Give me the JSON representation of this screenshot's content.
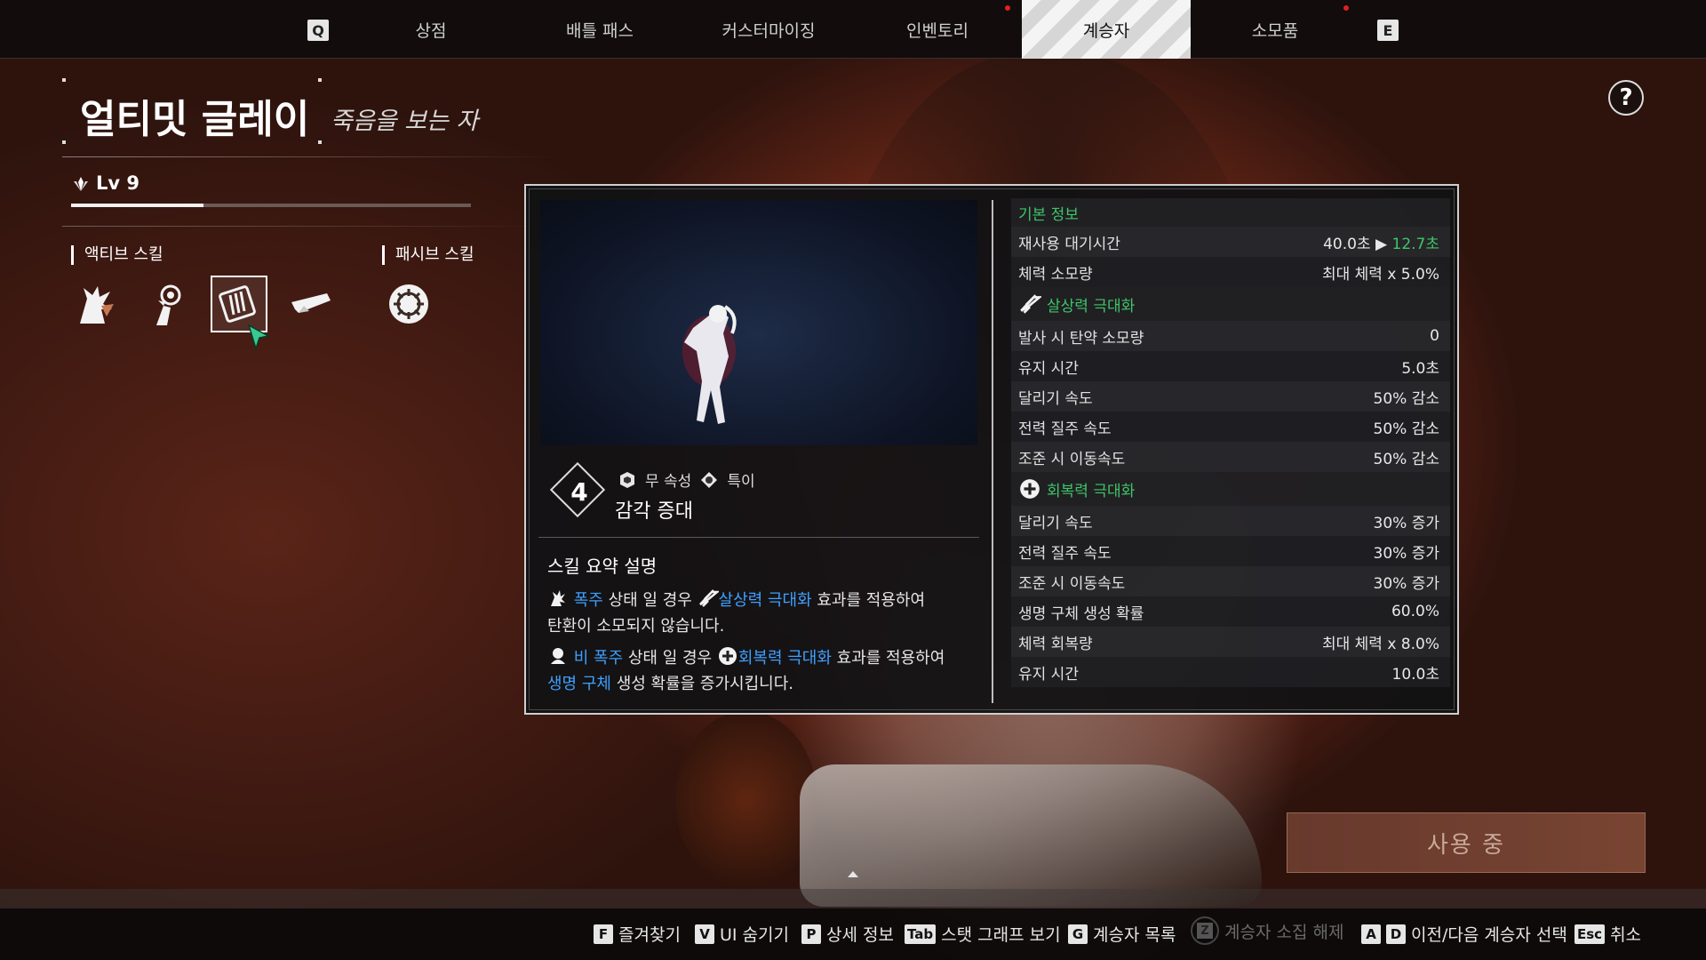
{
  "nav": {
    "left_key": "Q",
    "right_key": "E",
    "tabs": [
      {
        "label": "상점"
      },
      {
        "label": "배틀 패스"
      },
      {
        "label": "커스터마이징"
      },
      {
        "label": "인벤토리"
      },
      {
        "label": "계승자"
      },
      {
        "label": "소모품"
      }
    ],
    "active_tab": "계승자"
  },
  "hero": {
    "name": "얼티밋 글레이",
    "subtitle": "죽음을 보는 자",
    "level": "Lv 9",
    "xp_fraction": 0.33
  },
  "skills": {
    "active_label": "액티브 스킬",
    "passive_label": "패시브 스킬",
    "active_icons": [
      "skill-1-icon",
      "skill-2-icon",
      "skill-3-icon",
      "skill-4-icon"
    ],
    "selected_index": 2,
    "passive_icons": [
      "passive-skill-icon"
    ]
  },
  "detail": {
    "skill_number": "4",
    "attribute": "무 속성",
    "type": "특이",
    "skill_name": "감각 증대",
    "summary_title": "스킬 요약 설명",
    "line1_a": "폭주",
    "line1_b": " 상태 일 경우 ",
    "line1_c": "살상력 극대화",
    "line1_d": " 효과를 적용하여",
    "line1_e": "탄환이 소모되지 않습니다.",
    "line2_a": "비 폭주",
    "line2_b": " 상태 일 경우 ",
    "line2_c": "회복력 극대화",
    "line2_d": " 효과를 적용하여",
    "line2_e": "생명 구체",
    "line2_f": " 생성 확률을 증가시킵니다."
  },
  "stats": {
    "basic": {
      "title": "기본 정보",
      "rows": [
        {
          "label": "재사용 대기시간",
          "value": "40.0초",
          "value_new": "12.7초"
        },
        {
          "label": "체력 소모량",
          "value": "최대 체력 x 5.0%"
        }
      ]
    },
    "lethality": {
      "title": "살상력 극대화",
      "rows": [
        {
          "label": "발사 시 탄약 소모량",
          "value": "0"
        },
        {
          "label": "유지 시간",
          "value": "5.0초"
        },
        {
          "label": "달리기 속도",
          "value": "50% 감소"
        },
        {
          "label": "전력 질주 속도",
          "value": "50% 감소"
        },
        {
          "label": "조준 시 이동속도",
          "value": "50% 감소"
        }
      ]
    },
    "recovery": {
      "title": "회복력 극대화",
      "rows": [
        {
          "label": "달리기 속도",
          "value": "30% 증가"
        },
        {
          "label": "전력 질주 속도",
          "value": "30% 증가"
        },
        {
          "label": "조준 시 이동속도",
          "value": "30% 증가"
        },
        {
          "label": "생명 구체 생성 확률",
          "value": "60.0%"
        },
        {
          "label": "체력 회복량",
          "value": "최대 체력 x 8.0%"
        },
        {
          "label": "유지 시간",
          "value": "10.0초"
        }
      ]
    }
  },
  "use_button": "사용 중",
  "help": "?",
  "hints": [
    {
      "key": "F",
      "label": "즐겨찾기"
    },
    {
      "key": "V",
      "label": "UI 숨기기"
    },
    {
      "key": "P",
      "label": "상세 정보"
    },
    {
      "key": "Tab",
      "label": "스탯 그래프 보기"
    },
    {
      "key": "G",
      "label": "계승자 목록"
    },
    {
      "key": "Z",
      "label": "계승자 소집 해제"
    },
    {
      "key": "A",
      "key2": "D",
      "label": "이전/다음 계승자 선택"
    },
    {
      "key": "Esc",
      "label": "취소"
    }
  ],
  "colors": {
    "accent_green": "#3fc56a",
    "highlight_blue": "#3ea0ff",
    "notification_red": "#e02020"
  }
}
